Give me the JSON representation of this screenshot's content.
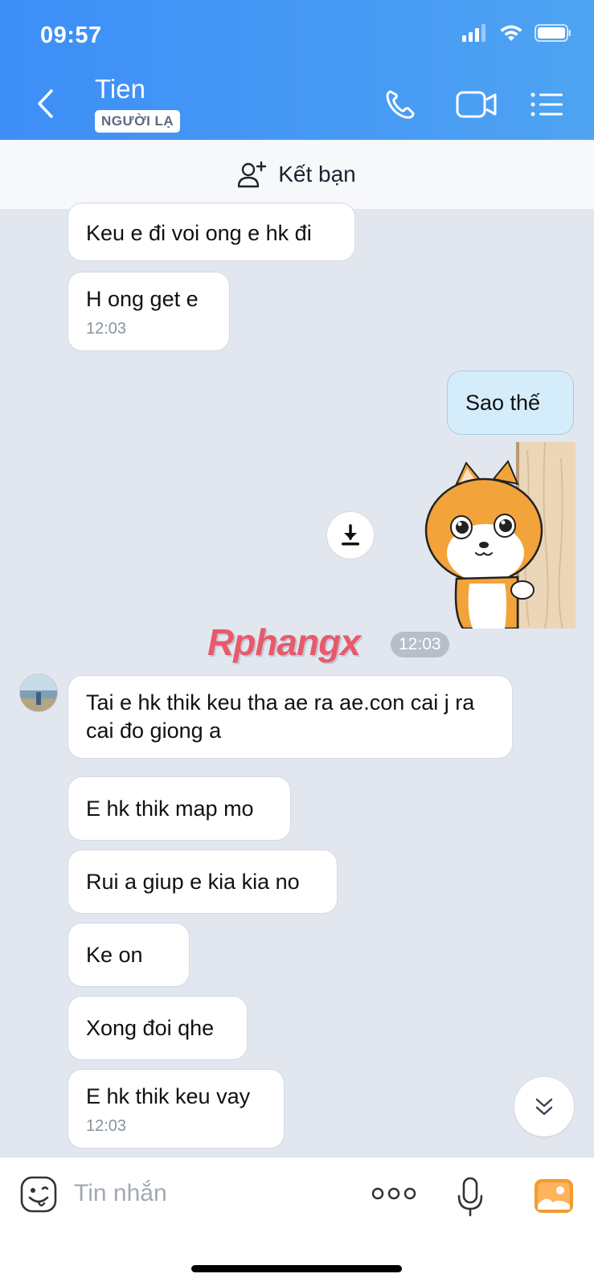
{
  "status_bar": {
    "time": "09:57"
  },
  "header": {
    "contact_name": "Tien",
    "badge": "NGƯỜI LẠ"
  },
  "friend_bar": {
    "label": "Kết bạn"
  },
  "messages": {
    "m1": {
      "text": "Keu e đi voi ong e hk đi"
    },
    "m2": {
      "text": "H ong get e",
      "time": "12:03"
    },
    "m3": {
      "text": "Sao thế"
    },
    "sticker_time": "12:03",
    "m4": {
      "text": "Tai e hk thik keu tha ae ra ae.con cai j ra cai đo giong a"
    },
    "m5": {
      "text": "E hk thik map mo"
    },
    "m6": {
      "text": "Rui a giup e kia kia no"
    },
    "m7": {
      "text": "Ke on"
    },
    "m8": {
      "text": "Xong đoi qhe"
    },
    "m9": {
      "text": "E hk thik keu vay",
      "time": "12:03"
    }
  },
  "watermark": "Rphangx",
  "input": {
    "placeholder": "Tin nhắn"
  },
  "colors": {
    "header_start": "#3d8ef7",
    "header_end": "#4ea3f2",
    "chat_bg": "#e2e7ef",
    "sent_bubble": "#d5ecfb"
  }
}
